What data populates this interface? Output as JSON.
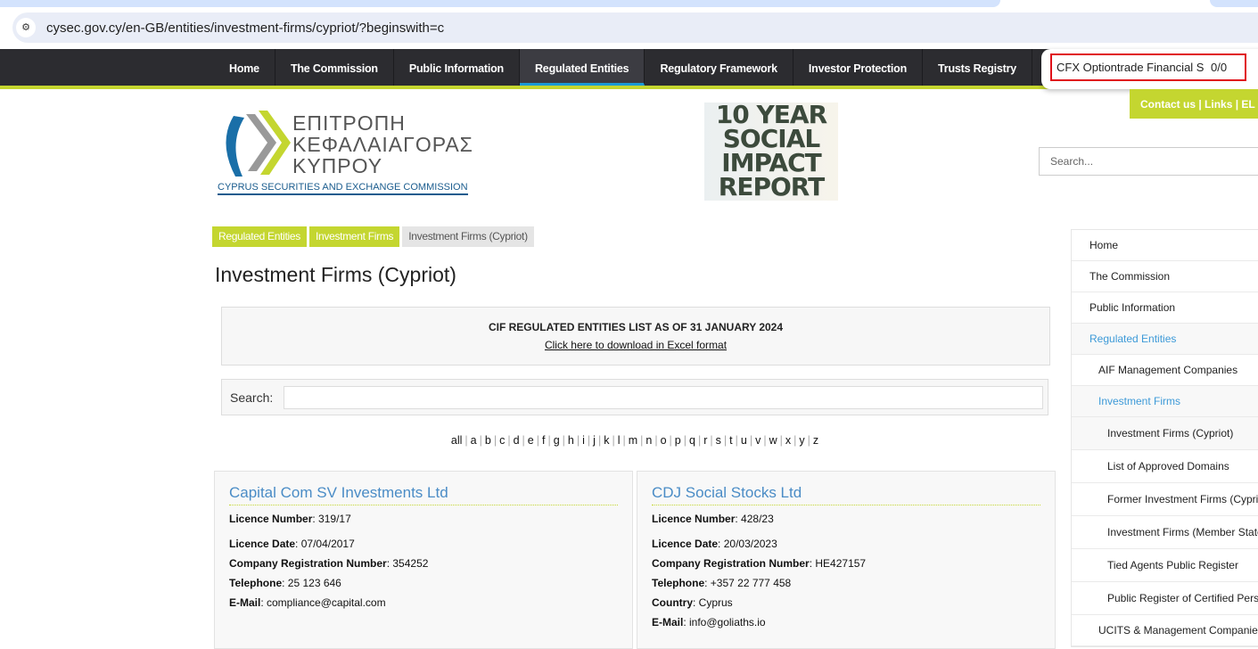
{
  "browser": {
    "url": "cysec.gov.cy/en-GB/entities/investment-firms/cypriot/?beginswith=c",
    "site_info_icon": "tune-icon"
  },
  "find_bar": {
    "query": "CFX Optiontrade Financial Se",
    "count": "0/0"
  },
  "nav": [
    "Home",
    "The Commission",
    "Public Information",
    "Regulated Entities",
    "Regulatory Framework",
    "Investor Protection",
    "Trusts Registry"
  ],
  "top_links": "Contact us  |  Links  |  EL / E",
  "logo": {
    "greek": "ΕΠΙΤΡΟΠΗ ΚΕΦΑΛΑΙΑΓΟΡΑΣ ΚΥΠΡΟΥ",
    "english": "CYPRUS SECURITIES AND EXCHANGE COMMISSION"
  },
  "banner": {
    "l1": "10 YEAR",
    "l2": "SOCIAL",
    "l3": "IMPACT",
    "l4": "REPORT"
  },
  "site_search": {
    "placeholder": "Search..."
  },
  "breadcrumb": [
    "Regulated Entities",
    "Investment Firms",
    "Investment Firms (Cypriot)"
  ],
  "page_title": "Investment Firms (Cypriot)",
  "info": {
    "heading": "CIF REGULATED ENTITIES LIST AS OF 31 JANUARY 2024",
    "download": "Click here to download in Excel format"
  },
  "filter": {
    "label": "Search:",
    "value": ""
  },
  "alphabet": [
    "all",
    "a",
    "b",
    "c",
    "d",
    "e",
    "f",
    "g",
    "h",
    "i",
    "j",
    "k",
    "l",
    "m",
    "n",
    "o",
    "p",
    "q",
    "r",
    "s",
    "t",
    "u",
    "v",
    "w",
    "x",
    "y",
    "z"
  ],
  "firms": [
    {
      "name": "Capital Com SV Investments Ltd",
      "fields": [
        [
          "Licence Number",
          ": 319/17"
        ],
        [
          "Licence Date",
          ": 07/04/2017"
        ],
        [
          "Company Registration Number",
          ": 354252"
        ],
        [
          "Telephone",
          ": 25 123 646"
        ],
        [
          "E-Mail",
          ": compliance@capital.com"
        ]
      ]
    },
    {
      "name": "CDJ Social Stocks Ltd",
      "fields": [
        [
          "Licence Number",
          ": 428/23"
        ],
        [
          "Licence Date",
          ": 20/03/2023"
        ],
        [
          "Company Registration Number",
          ": HE427157"
        ],
        [
          "Telephone",
          ": +357 22 777 458"
        ],
        [
          "Country",
          ": Cyprus"
        ],
        [
          "E-Mail",
          ": info@goliaths.io"
        ]
      ]
    }
  ],
  "sidebar": [
    {
      "label": "Home",
      "level": 1
    },
    {
      "label": "The Commission",
      "level": 1
    },
    {
      "label": "Public Information",
      "level": 1
    },
    {
      "label": "Regulated Entities",
      "level": 1,
      "state": "sel"
    },
    {
      "label": "AIF Management Companies",
      "level": 2
    },
    {
      "label": "Investment Firms",
      "level": 2,
      "state": "sel"
    },
    {
      "label": "Investment Firms (Cypriot)",
      "level": 3,
      "state": "cur"
    },
    {
      "label": "List of Approved Domains",
      "level": 3
    },
    {
      "label": "Former Investment Firms (Cypriot)",
      "level": 3
    },
    {
      "label": "Investment Firms (Member States)",
      "level": 3
    },
    {
      "label": "Tied Agents Public Register",
      "level": 3
    },
    {
      "label": "Public Register of Certified Persons",
      "level": 3
    },
    {
      "label": "UCITS & Management Companies",
      "level": 2
    }
  ]
}
